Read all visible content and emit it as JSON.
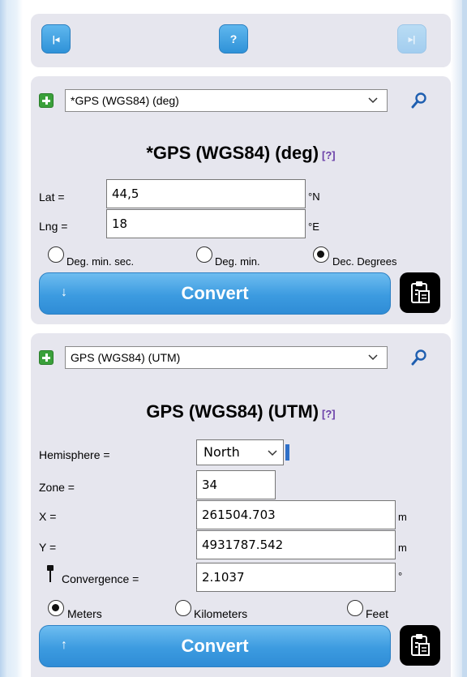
{
  "nav": {
    "first_label": "|◂",
    "help_label": "?",
    "last_label": "▸|"
  },
  "source": {
    "system_select": "*GPS (WGS84) (deg)",
    "title": "*GPS (WGS84) (deg)",
    "help": "[?]",
    "lat_label": "Lat =",
    "lat_value": "44,5",
    "lat_unit": "°N",
    "lng_label": "Lng =",
    "lng_value": "18",
    "lng_unit": "°E",
    "format_options": [
      "Deg. min. sec.",
      "Deg. min.",
      "Dec. Degrees"
    ],
    "format_selected": "Dec. Degrees",
    "convert_label": "Convert",
    "convert_arrow": "↓"
  },
  "target": {
    "system_select": "GPS (WGS84) (UTM)",
    "title": "GPS (WGS84) (UTM)",
    "help": "[?]",
    "hemisphere_label": "Hemisphere =",
    "hemisphere_value": "North",
    "zone_label": "Zone =",
    "zone_value": "34",
    "x_label": "X =",
    "x_value": "261504.703",
    "x_unit": "m",
    "y_label": "Y =",
    "y_value": "4931787.542",
    "y_unit": "m",
    "convergence_label": "Convergence =",
    "convergence_value": "2.1037",
    "convergence_unit": "°",
    "unit_options": [
      "Meters",
      "Kilometers",
      "Feet"
    ],
    "unit_selected": "Meters",
    "convert_label": "Convert",
    "convert_arrow": "↑"
  },
  "colors": {
    "panel": "#e6e6ee",
    "button_blue": "#3c9be0",
    "plus_green": "#3aa03a",
    "help_purple": "#6a3fa8"
  }
}
